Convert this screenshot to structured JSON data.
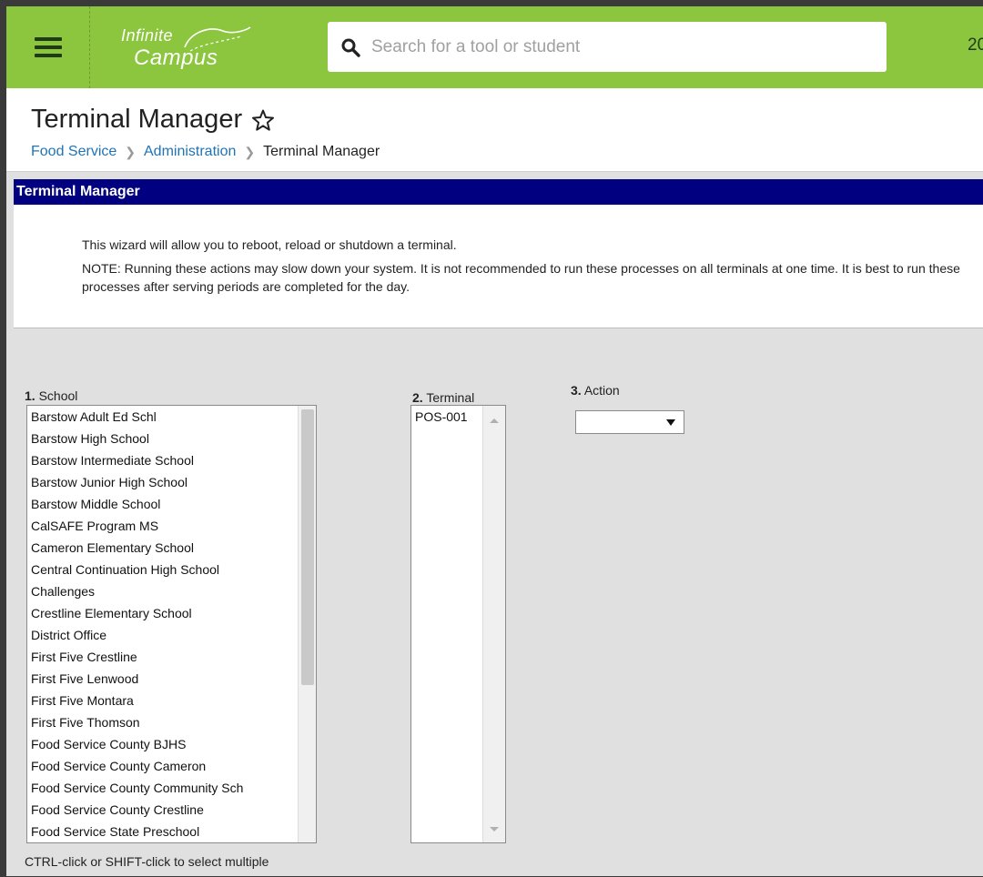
{
  "topbar": {
    "logo_line1": "Infinite",
    "logo_line2": "Campus",
    "search_placeholder": "Search for a tool or student",
    "year_partial": "20"
  },
  "page": {
    "title": "Terminal Manager",
    "breadcrumbs": [
      "Food Service",
      "Administration",
      "Terminal Manager"
    ]
  },
  "pane": {
    "header": "Terminal Manager",
    "intro": "This wizard will allow you to reboot, reload or shutdown a terminal.",
    "note": "NOTE: Running these actions may slow down your system. It is not recommended to run these processes on all terminals at one time. It is best to run these processes after serving periods are completed for the day."
  },
  "school": {
    "number": "1.",
    "label": "School",
    "items": [
      "Barstow Adult Ed Schl",
      "Barstow High School",
      "Barstow Intermediate School",
      "Barstow Junior High School",
      "Barstow Middle School",
      "CalSAFE Program MS",
      "Cameron Elementary School",
      "Central Continuation High School",
      "Challenges",
      "Crestline Elementary School",
      "District Office",
      "First Five Crestline",
      "First Five Lenwood",
      "First Five Montara",
      "First Five Thomson",
      "Food Service County BJHS",
      "Food Service County Cameron",
      "Food Service County Community Sch",
      "Food Service County Crestline",
      "Food Service State Preschool"
    ],
    "hint": "CTRL-click or SHIFT-click to select multiple"
  },
  "terminal": {
    "number": "2.",
    "label": "Terminal",
    "items": [
      "POS-001"
    ]
  },
  "action": {
    "number": "3.",
    "label": "Action",
    "selected": ""
  },
  "colors": {
    "topbar": "#8cc63f",
    "pane_header": "#000080",
    "link": "#1f73b7",
    "content_bg": "#e0e0e0"
  }
}
